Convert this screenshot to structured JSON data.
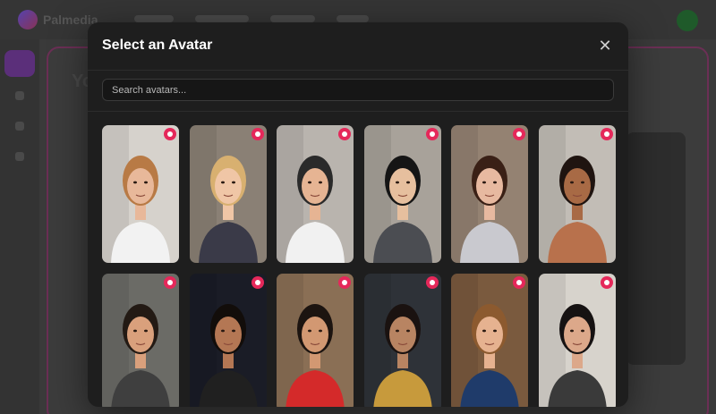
{
  "background": {
    "brand": "Palmedia"
  },
  "modal": {
    "title": "Select an Avatar",
    "close_icon": "close-icon",
    "search": {
      "placeholder": "Search avatars..."
    }
  },
  "colors": {
    "modal_bg": "#1e1e1e",
    "badge": "#e5285a",
    "border": "#2c2c2c"
  },
  "avatars": [
    {
      "bg": "#d6d2cc",
      "skin": "#e8b89a",
      "hair": "#b87a45",
      "shirt": "#f2f2f2",
      "badge_icon": "record-icon"
    },
    {
      "bg": "#8a8075",
      "skin": "#f0c6a6",
      "hair": "#d8b070",
      "shirt": "#3a3a48",
      "badge_icon": "record-icon"
    },
    {
      "bg": "#b9b4ae",
      "skin": "#e6b493",
      "hair": "#2a2a2a",
      "shirt": "#f1f1f1",
      "badge_icon": "record-icon"
    },
    {
      "bg": "#a8a29a",
      "skin": "#e6bf9e",
      "hair": "#151515",
      "shirt": "#4b4d52",
      "badge_icon": "record-icon"
    },
    {
      "bg": "#948272",
      "skin": "#e7b9a0",
      "hair": "#3a2016",
      "shirt": "#c9c9cf",
      "badge_icon": "record-icon"
    },
    {
      "bg": "#c2bdb6",
      "skin": "#a86a45",
      "hair": "#1f1410",
      "shirt": "#b8714c",
      "badge_icon": "record-icon"
    },
    {
      "bg": "#6b6b66",
      "skin": "#d9a07c",
      "hair": "#231a14",
      "shirt": "#3f3f3f",
      "badge_icon": "record-icon"
    },
    {
      "bg": "#1a1c26",
      "skin": "#b47754",
      "hair": "#120d0a",
      "shirt": "#202020",
      "badge_icon": "record-icon"
    },
    {
      "bg": "#8a6f55",
      "skin": "#d29872",
      "hair": "#1c1410",
      "shirt": "#d42a2a",
      "badge_icon": "record-icon"
    },
    {
      "bg": "#2e3238",
      "skin": "#b88462",
      "hair": "#1a1210",
      "shirt": "#c79a3c",
      "badge_icon": "record-icon"
    },
    {
      "bg": "#7a5a3e",
      "skin": "#e6b290",
      "hair": "#8c5a2f",
      "shirt": "#1f3b6a",
      "badge_icon": "record-icon"
    },
    {
      "bg": "#d7d3cc",
      "skin": "#dca88a",
      "hair": "#161212",
      "shirt": "#3a3a3a",
      "badge_icon": "record-icon"
    }
  ]
}
